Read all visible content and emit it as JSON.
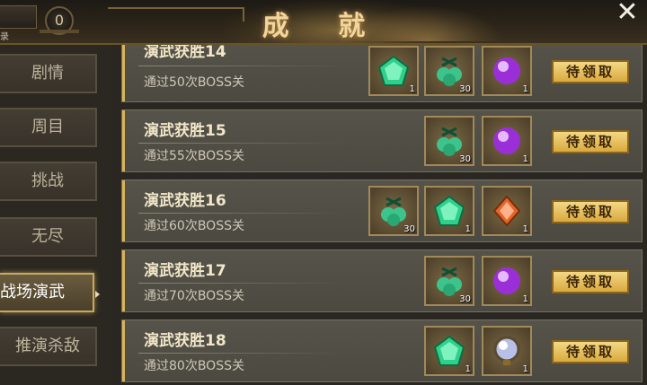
{
  "header": {
    "title": "成 就",
    "zero_badge": "0",
    "left_fragment": "录"
  },
  "sidebar": {
    "items": [
      {
        "label": "剧情"
      },
      {
        "label": "周目"
      },
      {
        "label": "挑战"
      },
      {
        "label": "无尽"
      },
      {
        "label": "战场演武"
      },
      {
        "label": "推演杀敌"
      }
    ],
    "active_index": 4
  },
  "rows": [
    {
      "title": "演武获胜14",
      "desc": "通过50次BOSS关",
      "claim": "待领取",
      "rewards": [
        {
          "icon": "emerald-gem",
          "count": "1"
        },
        {
          "icon": "jade-pouch",
          "count": "30"
        },
        {
          "icon": "purple-orb",
          "count": "1"
        }
      ]
    },
    {
      "title": "演武获胜15",
      "desc": "通过55次BOSS关",
      "claim": "待领取",
      "rewards": [
        {
          "icon": "jade-pouch",
          "count": "30"
        },
        {
          "icon": "purple-orb",
          "count": "1"
        }
      ]
    },
    {
      "title": "演武获胜16",
      "desc": "通过60次BOSS关",
      "claim": "待领取",
      "rewards": [
        {
          "icon": "jade-pouch",
          "count": "30"
        },
        {
          "icon": "emerald-gem",
          "count": "1"
        },
        {
          "icon": "orange-crystal",
          "count": "1"
        }
      ]
    },
    {
      "title": "演武获胜17",
      "desc": "通过70次BOSS关",
      "claim": "待领取",
      "rewards": [
        {
          "icon": "jade-pouch",
          "count": "30"
        },
        {
          "icon": "purple-orb",
          "count": "1"
        }
      ]
    },
    {
      "title": "演武获胜18",
      "desc": "通过80次BOSS关",
      "claim": "待领取",
      "rewards": [
        {
          "icon": "emerald-gem",
          "count": "1"
        },
        {
          "icon": "pearl-amulet",
          "count": "1"
        }
      ]
    }
  ],
  "colors": {
    "claim_gold": "#e6bf5c",
    "accent_gold": "#d7b45a",
    "row_bg": "#524f46"
  }
}
